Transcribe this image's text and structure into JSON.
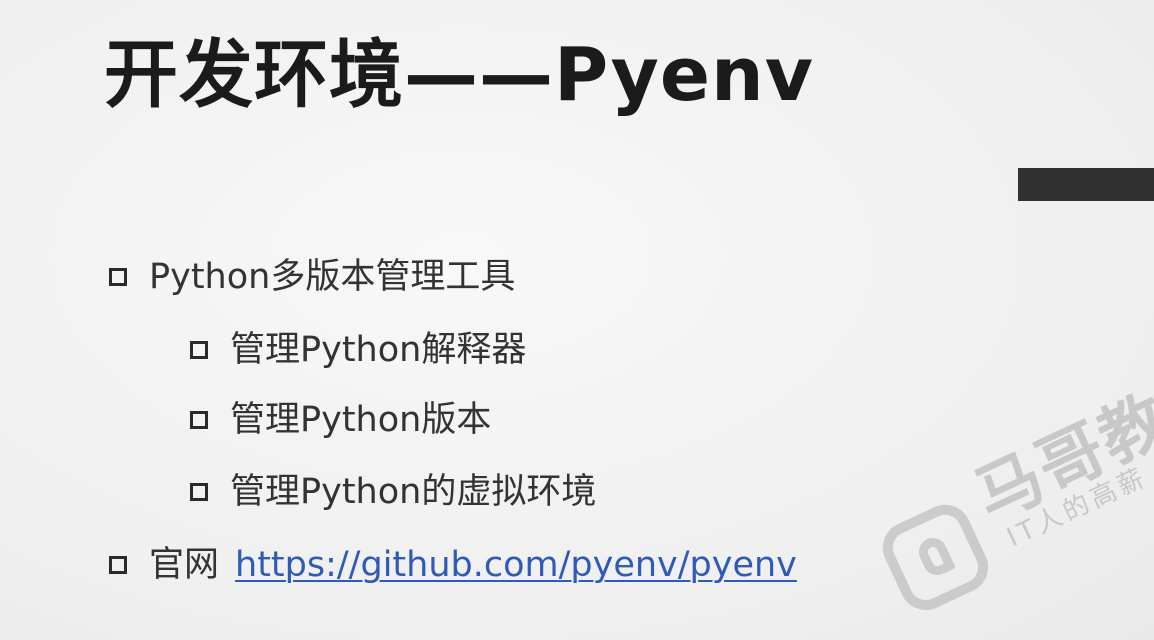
{
  "slide": {
    "title": "开发环境——Pyenv",
    "bullets": [
      {
        "text": "Python多版本管理工具"
      },
      {
        "text": "管理Python解释器"
      },
      {
        "text": "管理Python版本"
      },
      {
        "text": "管理Python的虚拟环境"
      }
    ],
    "official_site": {
      "label": "官网",
      "url": "https://github.com/pyenv/pyenv"
    },
    "watermark": {
      "brand": "马哥教",
      "tagline": "IT人的高薪"
    }
  },
  "colors": {
    "background": "#f3f3f3",
    "title": "#1b1b1b",
    "text": "#333333",
    "link": "#2e5bb8",
    "accent_bar": "#303030"
  }
}
